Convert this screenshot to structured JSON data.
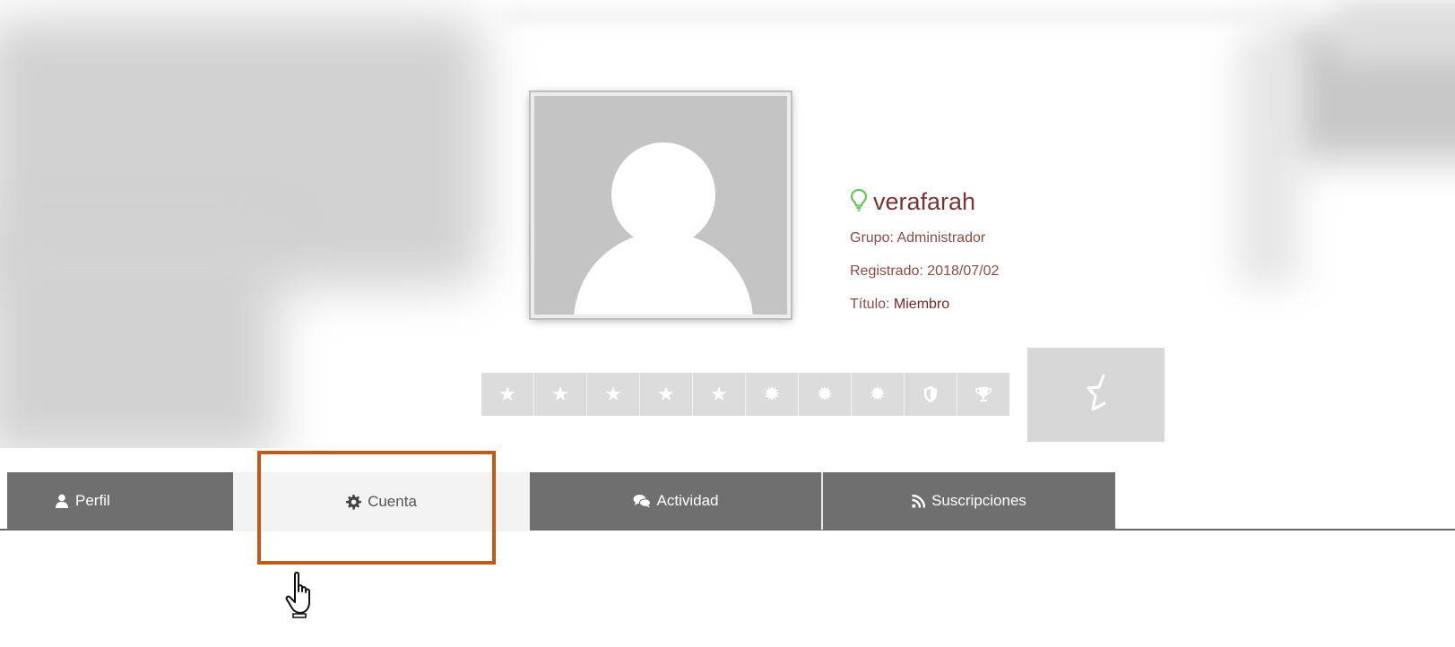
{
  "profile": {
    "username": "verafarah",
    "status_icon": "lightbulb-icon",
    "group_label": "Grupo:",
    "group_value": "Administrador",
    "registered_label": "Registrado:",
    "registered_value": "2018/07/02",
    "title_label": "Título:",
    "title_value": "Miembro",
    "avatar_icon": "default-user-avatar",
    "rank_icon": "half-star-icon"
  },
  "badges": [
    {
      "icon": "star-icon"
    },
    {
      "icon": "star-icon"
    },
    {
      "icon": "star-icon"
    },
    {
      "icon": "star-icon"
    },
    {
      "icon": "star-icon"
    },
    {
      "icon": "sun-icon"
    },
    {
      "icon": "sun-icon"
    },
    {
      "icon": "sun-icon"
    },
    {
      "icon": "shield-icon"
    },
    {
      "icon": "trophy-icon"
    }
  ],
  "tabs": [
    {
      "label": "Perfil",
      "icon": "user-icon",
      "active": false
    },
    {
      "label": "Cuenta",
      "icon": "gear-icon",
      "active": true
    },
    {
      "label": "Actividad",
      "icon": "comments-icon",
      "active": false
    },
    {
      "label": "Suscripciones",
      "icon": "rss-icon",
      "active": false
    }
  ],
  "colors": {
    "highlight_border": "#c05a1b",
    "tab_bg": "#6f6f6f",
    "tab_active_bg": "#f3f3f3",
    "username_color": "#7a3434",
    "status_icon_color": "#6ac259"
  }
}
